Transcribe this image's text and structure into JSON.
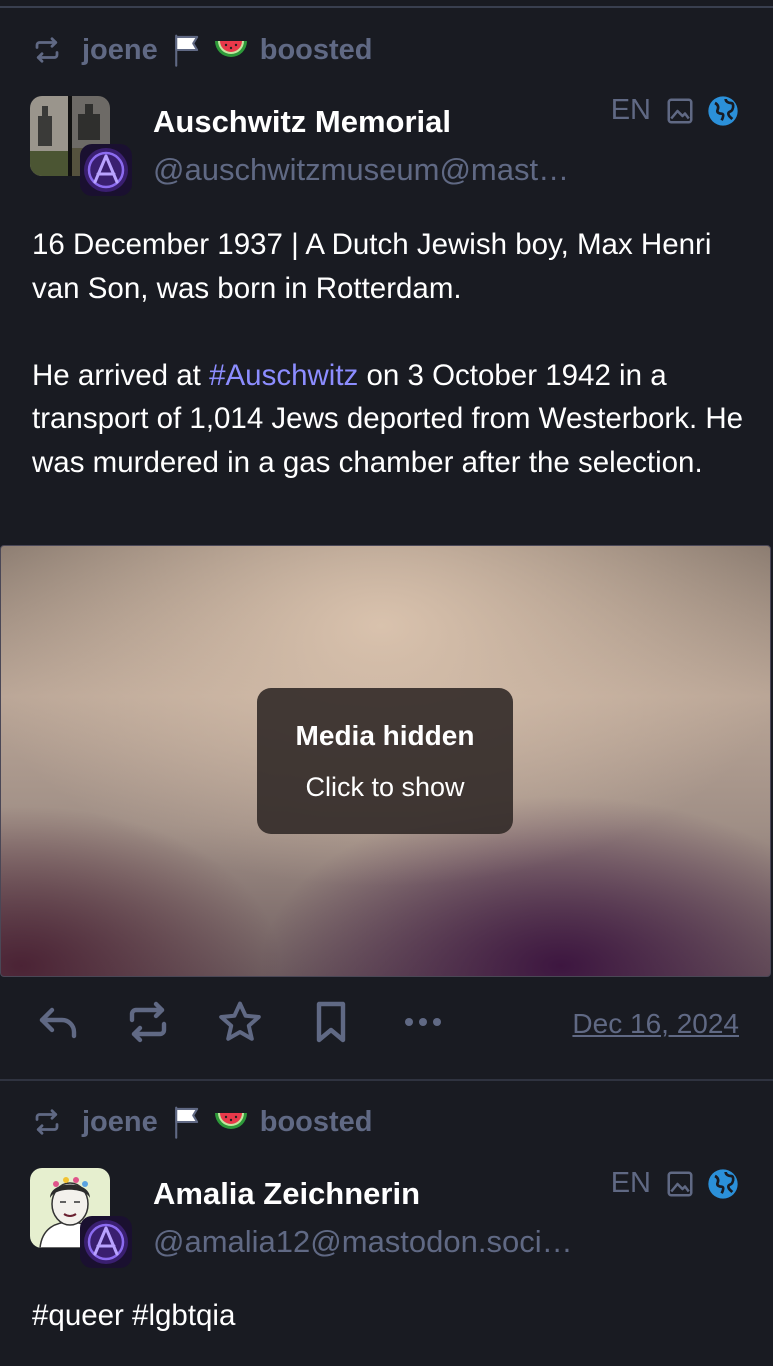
{
  "posts": [
    {
      "booster_name": "joene",
      "boost_label": "boosted",
      "author_name": "Auschwitz Memorial",
      "author_handle": "@auschwitzmuseum@mast…",
      "language": "EN",
      "paragraph1": "16 December 1937 | A Dutch Jewish boy, Max Henri van Son, was born in Rotterdam.",
      "paragraph2_before": "He arrived at ",
      "paragraph2_hashtag": "#Auschwitz",
      "paragraph2_after": " on 3 October 1942 in a transport of 1,014 Jews deported from Westerbork. He was murdered in a gas chamber after the selection.",
      "media_title": "Media hidden",
      "media_subtitle": "Click to show",
      "date": "Dec 16, 2024"
    },
    {
      "booster_name": "joene",
      "boost_label": "boosted",
      "author_name": "Amalia Zeichnerin",
      "author_handle": "@amalia12@mastodon.soci…",
      "language": "EN",
      "content": "#queer #lgbtqia"
    }
  ],
  "icons": {
    "boost": "boost-icon",
    "flag": "flag-icon",
    "watermelon": "watermelon-emoji",
    "image": "image-icon",
    "globe": "globe-icon",
    "reply": "reply-icon",
    "reblog": "reblog-icon",
    "favourite": "star-icon",
    "bookmark": "bookmark-icon",
    "more": "more-icon"
  },
  "colors": {
    "background": "#191b22",
    "muted": "#606984",
    "hashtag": "#8c8dff",
    "globe": "#2b90d9"
  }
}
